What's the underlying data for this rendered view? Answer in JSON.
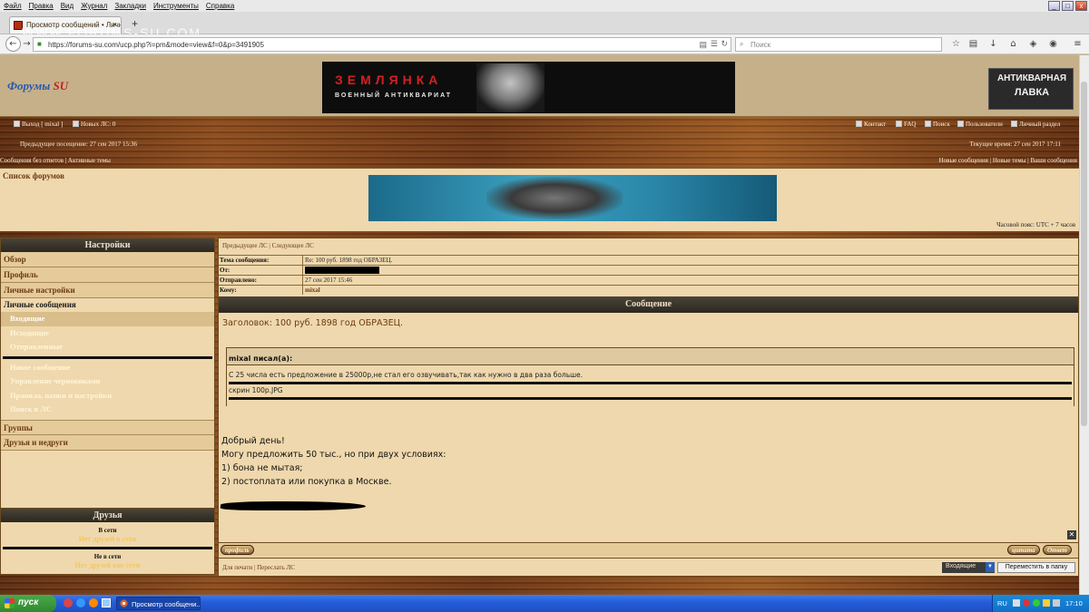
{
  "browser": {
    "menu": [
      "Файл",
      "Правка",
      "Вид",
      "Журнал",
      "Закладки",
      "Инструменты",
      "Справка"
    ],
    "tab_title": "Просмотр сообщений • Личн...",
    "url": "https://forums-su.com/ucp.php?i=pm&mode=view&f=0&p=3491905",
    "search_placeholder": "Поиск",
    "watermark": "WWW.FORUMS-SU.COM"
  },
  "header": {
    "logo_text": "Форумы ",
    "logo_su": "SU",
    "banner_title": "ЗЕМЛЯНКА",
    "banner_sub": "ВОЕННЫЙ АНТИКВАРИАТ",
    "banner2_line1": "АНТИКВАРНАЯ",
    "banner2_line2": "ЛАВКА"
  },
  "topnav": {
    "logout": "Выход [ mixal ]",
    "new_pm": "Новых ЛС: 0",
    "contact": "Контакт",
    "faq": "FAQ",
    "search": "Поиск",
    "members": "Пользователи",
    "ucp": "Личный раздел",
    "last_visit": "Предыдущее посещение: 27 сен 2017 15:36",
    "current_time": "Текущее время: 27 сен 2017 17:11",
    "unanswered": "Сообщения без ответов",
    "active": "Активные темы",
    "new_posts": "Новые сообщения",
    "new_topics": "Новые темы",
    "your_posts": "Ваши сообщения"
  },
  "forum_index": {
    "label": "Список форумов",
    "timezone": "Часовой пояс: UTC + 7 часов"
  },
  "sidebar": {
    "title": "Настройки",
    "overview": "Обзор",
    "profile": "Профиль",
    "prefs": "Личные настройки",
    "pm": "Личные сообщения",
    "inbox": "Входящие",
    "outbox": "Исходящие",
    "sent": "Отправленные",
    "compose": "Новое сообщение",
    "drafts": "Управление черновиками",
    "rules": "Правила, папки и настройки",
    "pm_search": "Поиск в ЛС",
    "groups": "Группы",
    "friends_foes": "Друзья и недруги"
  },
  "friends": {
    "title": "Друзья",
    "online": "В сети",
    "online_empty": "Нет друзей в сети",
    "offline": "Не в сети",
    "offline_empty": "Нет друзей вне сети"
  },
  "message": {
    "prev": "Предыдущее ЛС",
    "next": "Следующее ЛС",
    "subject_label": "Тема сообщения:",
    "subject": "Re: 100 руб. 1898 год ОБРАЗЕЦ.",
    "from_label": "От:",
    "sent_label": "Отправлено:",
    "sent": "27 сен 2017 15:46",
    "to_label": "Кому:",
    "to": "mixal",
    "section": "Сообщение",
    "title": "Заголовок: 100 руб. 1898 год ОБРАЗЕЦ.",
    "quote_author": "mixal писал(а):",
    "quote_text": "С 25 числа есть предложение в 25000р,не стал его озвучивать,так как нужно в два раза больше.",
    "quote_attach": "скрин 100р.JPG",
    "lines": [
      "Добрый день!",
      "Могу предложить 50 тыс., но при двух условиях:",
      "1) бона не мытая;",
      "2) постоплата или покупка в Москве."
    ],
    "profile_btn": "профиль",
    "quote_btn": "цитата",
    "reply_btn": "Ответ",
    "print": "Для печати",
    "forward": "Переслать ЛС",
    "folder": "Входящие",
    "move_btn": "Переместить в папку"
  },
  "taskbar": {
    "start": "пуск",
    "task": "Просмотр сообщени...",
    "lang": "RU",
    "clock": "17:10"
  }
}
